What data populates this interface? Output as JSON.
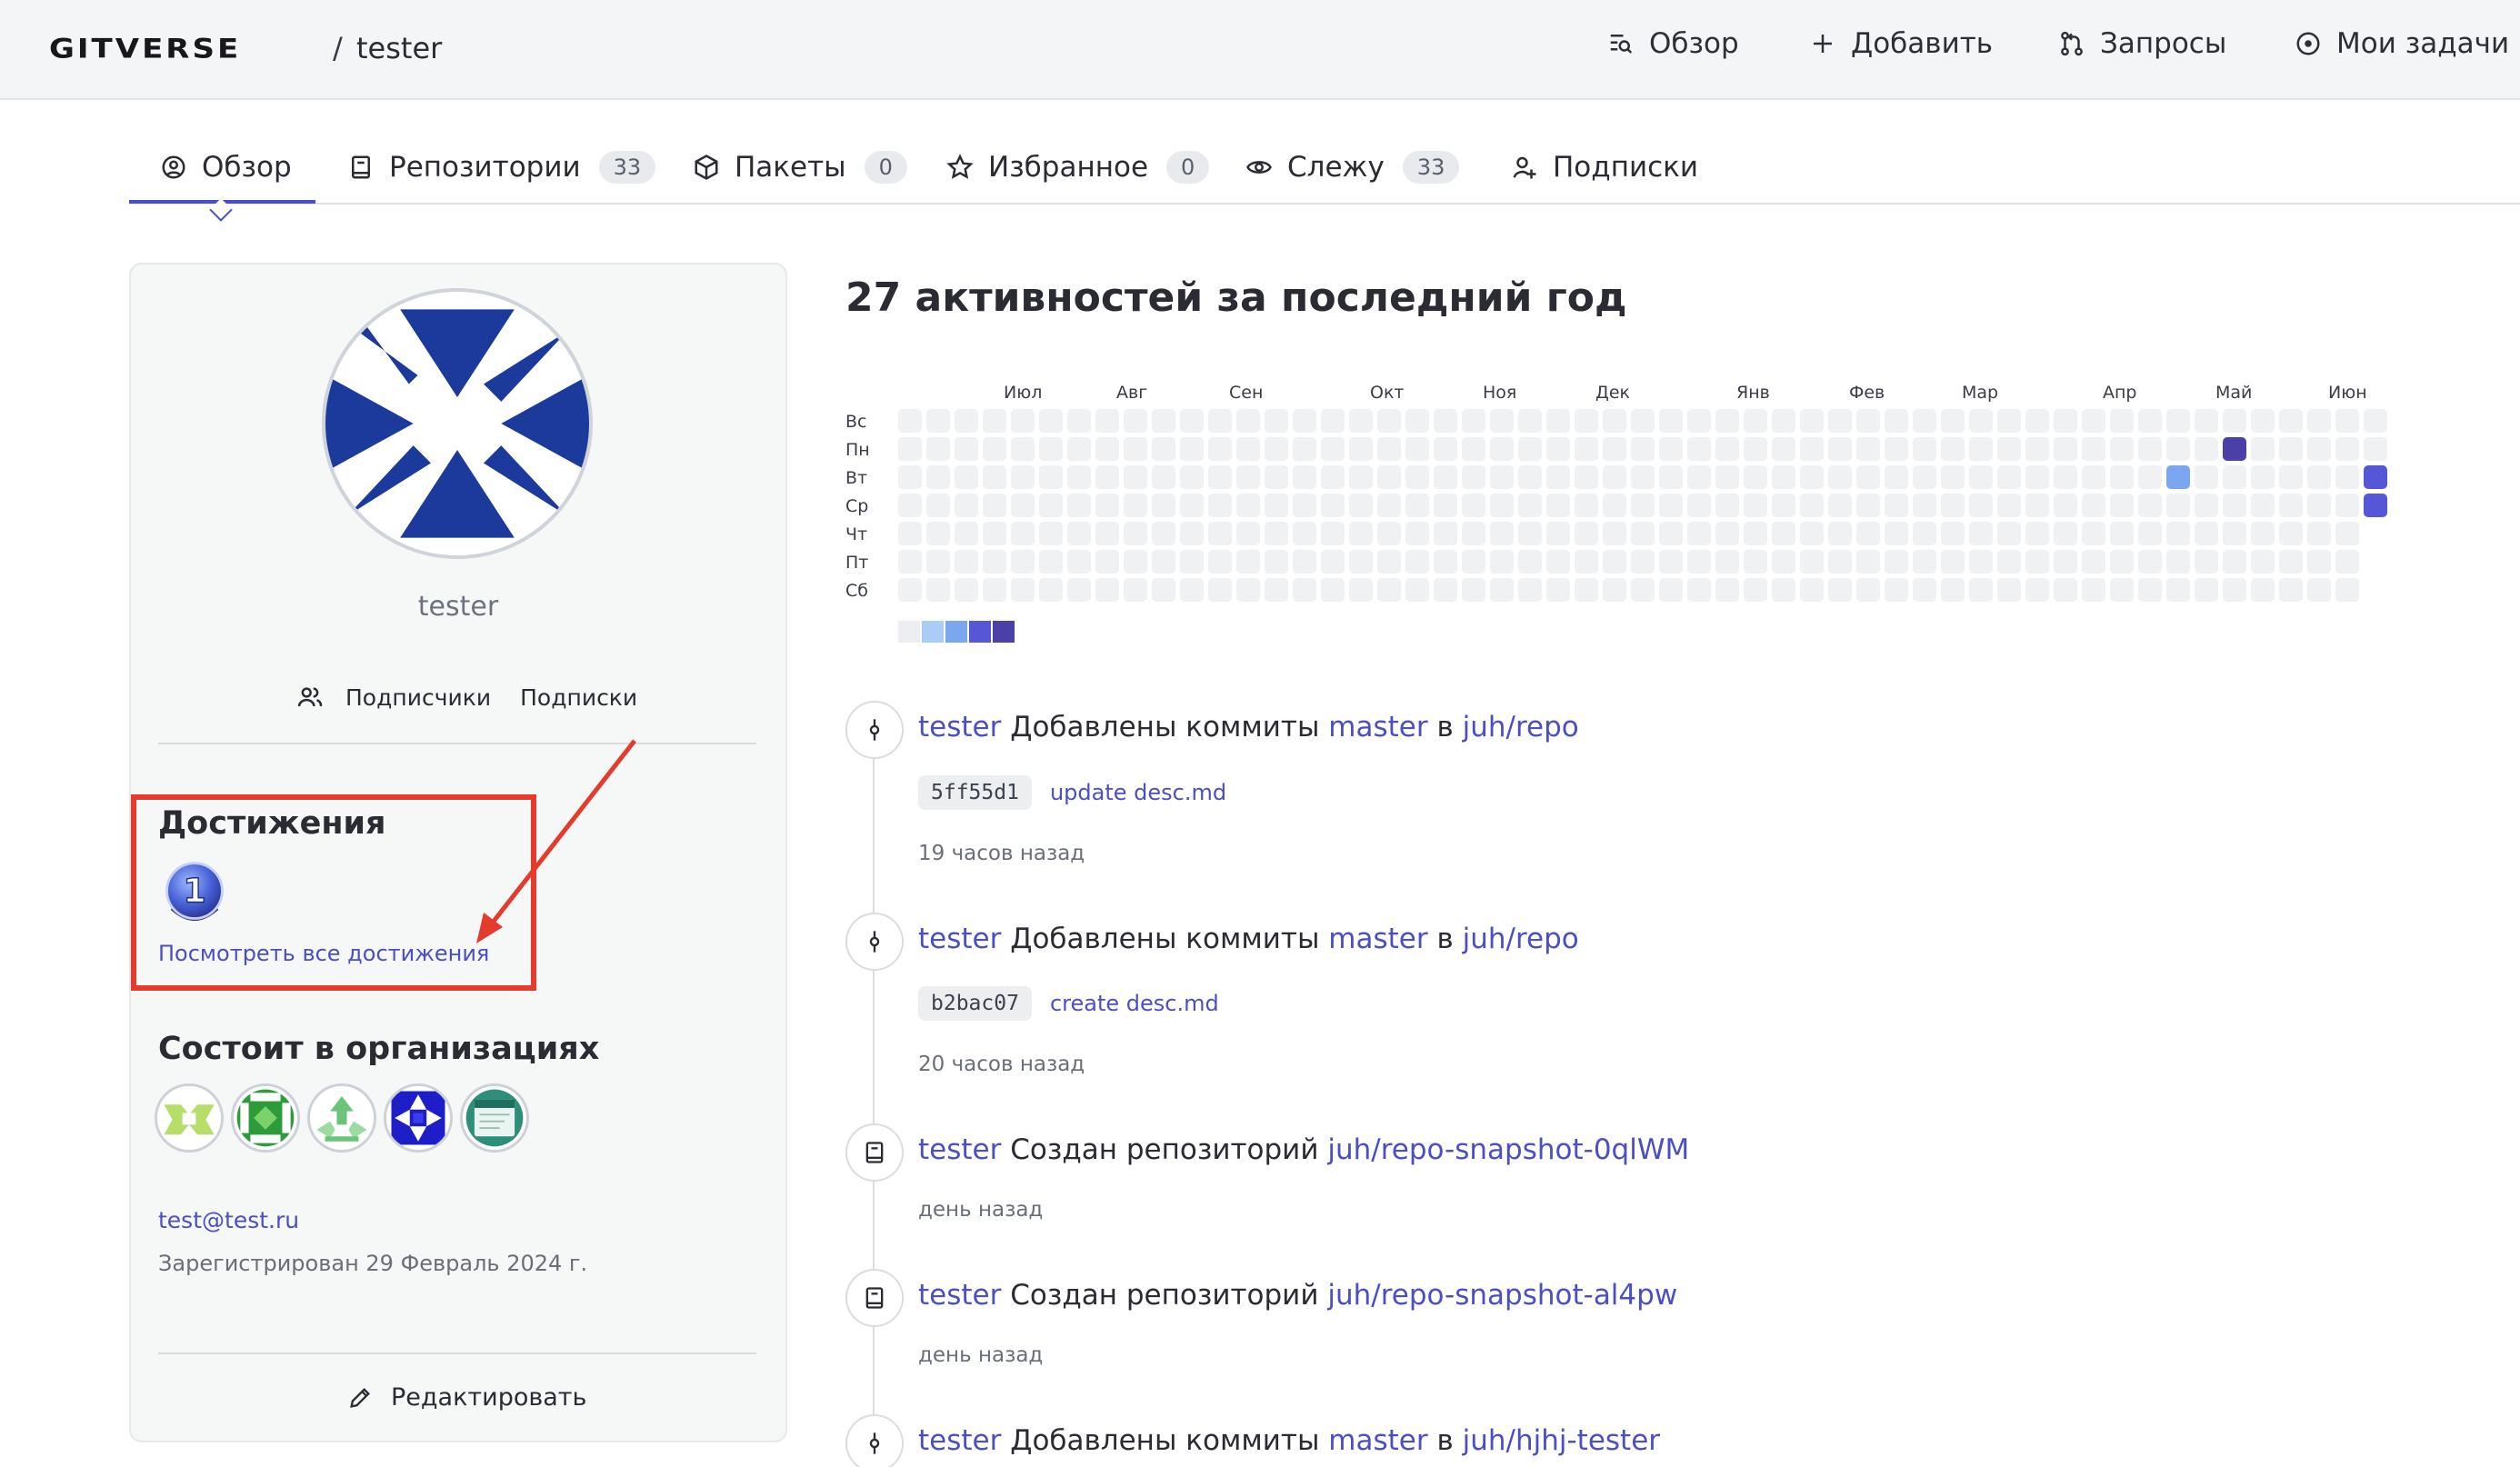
{
  "header": {
    "logo": "GITVERSE",
    "separator": "/",
    "user": "tester",
    "nav": [
      {
        "label": "Обзор",
        "icon": "overview-search-icon"
      },
      {
        "label": "Добавить",
        "icon": "plus-icon"
      },
      {
        "label": "Запросы",
        "icon": "pull-request-icon"
      },
      {
        "label": "Мои задачи",
        "icon": "issue-circle-icon"
      }
    ]
  },
  "tabs": [
    {
      "label": "Обзор",
      "count": null,
      "icon": "user-circle-icon",
      "active": true
    },
    {
      "label": "Репозитории",
      "count": "33",
      "icon": "book-icon"
    },
    {
      "label": "Пакеты",
      "count": "0",
      "icon": "package-icon"
    },
    {
      "label": "Избранное",
      "count": "0",
      "icon": "star-icon"
    },
    {
      "label": "Слежу",
      "count": "33",
      "icon": "eye-icon"
    },
    {
      "label": "Подписки",
      "count": null,
      "icon": "user-plus-icon"
    }
  ],
  "profile": {
    "username": "tester",
    "followers_label": "Подписчики",
    "following_label": "Подписки",
    "achievements_title": "Достижения",
    "achievement_badge": "1",
    "view_all_achievements": "Посмотреть все достижения",
    "orgs_title": "Состоит в организациях",
    "email": "test@test.ru",
    "registered": "Зарегистрирован 29 Февраль 2024 г.",
    "edit_label": "Редактировать"
  },
  "activity": {
    "title": "27 активностей за последний год",
    "months": [
      "Июл",
      "Авг",
      "Сен",
      "Окт",
      "Ноя",
      "Дек",
      "Янв",
      "Фев",
      "Мар",
      "Апр",
      "Май",
      "Июн"
    ],
    "weekdays": [
      "Вс",
      "Пн",
      "Вт",
      "Ср",
      "Чт",
      "Пт",
      "Сб"
    ],
    "level_colors": [
      "#ebedf0",
      "#a9cdf5",
      "#7aa7f0",
      "#5657d6",
      "#4b3fa8"
    ],
    "active_cells": [
      {
        "week": 45,
        "day": 2,
        "level": 2
      },
      {
        "week": 47,
        "day": 1,
        "level": 4
      },
      {
        "week": 52,
        "day": 2,
        "level": 3
      },
      {
        "week": 52,
        "day": 3,
        "level": 3
      }
    ]
  },
  "feed": [
    {
      "type": "commit",
      "user": "tester",
      "action": "Добавлены коммиты",
      "branch": "master",
      "in": "в",
      "repo": "juh/repo",
      "sha": "5ff55d1",
      "message": "update desc.md",
      "time": "19 часов назад"
    },
    {
      "type": "commit",
      "user": "tester",
      "action": "Добавлены коммиты",
      "branch": "master",
      "in": "в",
      "repo": "juh/repo",
      "sha": "b2bac07",
      "message": "create desc.md",
      "time": "20 часов назад"
    },
    {
      "type": "repo",
      "user": "tester",
      "action": "Создан репозиторий",
      "repo": "juh/repo-snapshot-0qlWM",
      "time": "день назад"
    },
    {
      "type": "repo",
      "user": "tester",
      "action": "Создан репозиторий",
      "repo": "juh/repo-snapshot-al4pw",
      "time": "день назад"
    },
    {
      "type": "commit",
      "user": "tester",
      "action": "Добавлены коммиты",
      "branch": "master",
      "in": "в",
      "repo": "juh/hjhj-tester"
    }
  ],
  "colors": {
    "accent": "#4b4fc4",
    "annotation_red": "#e43b2c",
    "avatar_blue": "#1b3a9c"
  }
}
